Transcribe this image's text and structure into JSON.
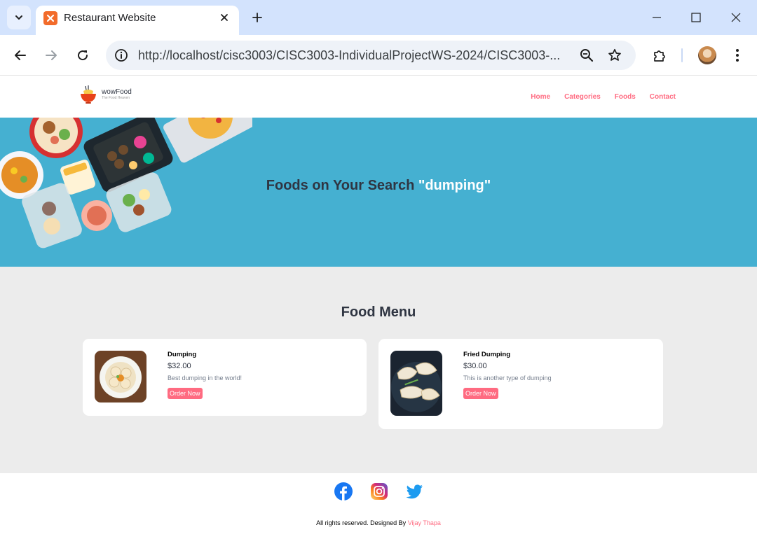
{
  "browser": {
    "tab_title": "Restaurant Website",
    "url": "http://localhost/cisc3003/CISC3003-IndividualProjectWS-2024/CISC3003-..."
  },
  "site": {
    "logo_name": "wowFood",
    "logo_tagline": "The Food Heaven",
    "nav": [
      "Home",
      "Categories",
      "Foods",
      "Contact"
    ]
  },
  "hero": {
    "title_prefix": "Foods on Your Search",
    "search_query": "\"dumping\""
  },
  "food_menu": {
    "heading": "Food Menu",
    "items": [
      {
        "name": "Dumping",
        "price": "$32.00",
        "description": "Best dumping in the world!",
        "button": "Order Now"
      },
      {
        "name": "Fried Dumping",
        "price": "$30.00",
        "description": "This is another type of dumping",
        "button": "Order Now"
      }
    ]
  },
  "footer": {
    "social_icons": [
      "facebook-icon",
      "instagram-icon",
      "twitter-icon"
    ],
    "copyright_prefix": "All rights reserved. Designed By",
    "author": "Vijay Thapa"
  },
  "colors": {
    "accent": "#ff6b81",
    "hero_bg": "#45b0d1",
    "menu_bg": "#ececec",
    "heading": "#2f3542"
  }
}
